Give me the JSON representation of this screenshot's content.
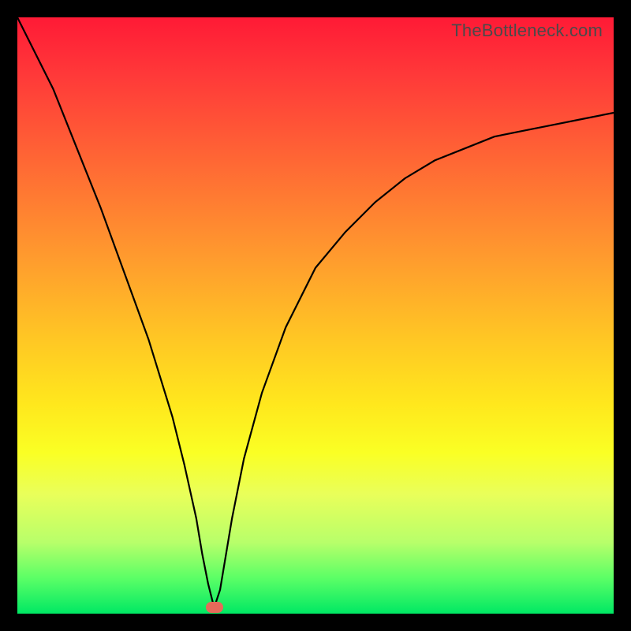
{
  "annotation": "TheBottleneck.com",
  "colors": {
    "curve": "#000000",
    "marker": "#e66a5a",
    "background": "#000000"
  },
  "chart_data": {
    "type": "line",
    "title": "",
    "xlabel": "",
    "ylabel": "",
    "xlim": [
      0,
      100
    ],
    "ylim": [
      0,
      100
    ],
    "grid": false,
    "legend": false,
    "annotations": [
      "TheBottleneck.com"
    ],
    "marker": {
      "x": 33,
      "y": 1
    },
    "series": [
      {
        "name": "bottleneck-curve",
        "x": [
          0,
          3,
          6,
          10,
          14,
          18,
          22,
          26,
          28,
          30,
          31,
          32,
          33,
          34,
          35,
          36,
          38,
          41,
          45,
          50,
          55,
          60,
          65,
          70,
          75,
          80,
          85,
          90,
          95,
          100
        ],
        "values": [
          100,
          94,
          88,
          78,
          68,
          57,
          46,
          33,
          25,
          16,
          10,
          5,
          1,
          4,
          10,
          16,
          26,
          37,
          48,
          58,
          64,
          69,
          73,
          76,
          78,
          80,
          81,
          82,
          83,
          84
        ]
      }
    ]
  }
}
